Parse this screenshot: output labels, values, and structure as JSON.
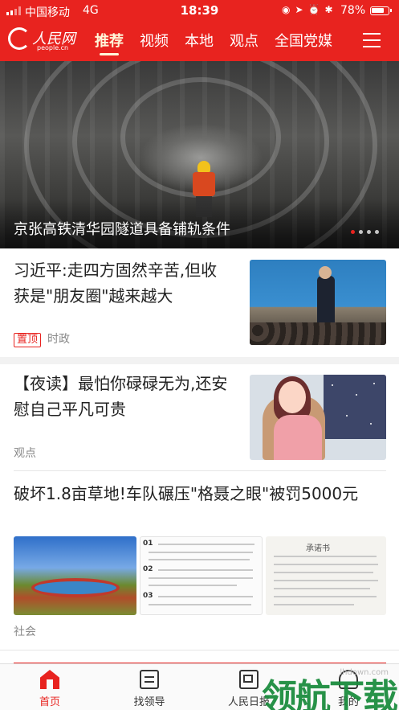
{
  "status_bar": {
    "carrier": "中国移动",
    "network": "4G",
    "time": "18:39",
    "battery": "78%",
    "battery_level": 0.78
  },
  "header": {
    "logo_text": "人民网",
    "logo_sub": "people.cn",
    "tabs": [
      {
        "label": "推荐",
        "active": true
      },
      {
        "label": "视频",
        "active": false
      },
      {
        "label": "本地",
        "active": false
      },
      {
        "label": "观点",
        "active": false
      },
      {
        "label": "全国党媒",
        "active": false
      }
    ],
    "accent_color": "#e8231f"
  },
  "hero": {
    "caption": "京张高铁清华园隧道具备铺轨条件",
    "slide_count": 4,
    "active_slide": 1
  },
  "feed": [
    {
      "title": "习近平:走四方固然辛苦,但收获是\"朋友圈\"越来越大",
      "tag": "置顶",
      "category": "时政"
    },
    {
      "title": "【夜读】最怕你碌碌无为,还安慰自己平凡可贵",
      "category": "观点"
    },
    {
      "title": "破坏1.8亩草地!车队碾压\"格聂之眼\"被罚5000元",
      "category": "社会",
      "document_heading": "承诺书"
    }
  ],
  "tabbar": [
    {
      "label": "首页",
      "icon": "home-icon",
      "active": true
    },
    {
      "label": "找领导",
      "icon": "chat-icon",
      "active": false
    },
    {
      "label": "人民日报",
      "icon": "newspaper-icon",
      "active": false
    },
    {
      "label": "我的",
      "icon": "user-icon",
      "active": false
    }
  ],
  "watermark": {
    "text": "领航下载",
    "site": "lhdown.com"
  }
}
